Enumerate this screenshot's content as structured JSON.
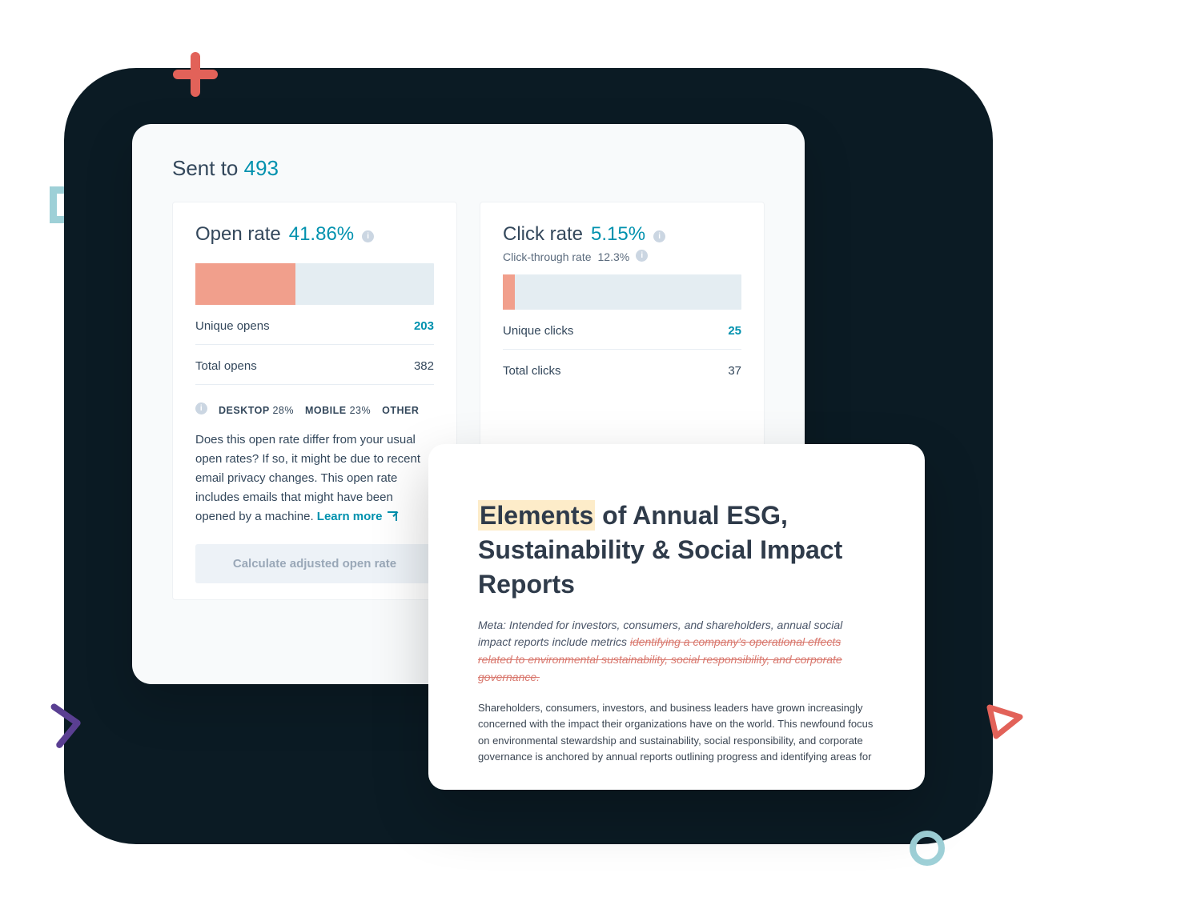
{
  "analytics": {
    "sent_label": "Sent to",
    "sent_count": "493",
    "open": {
      "title": "Open rate",
      "pct": "41.86%",
      "bar_width_pct": 41.86,
      "rows": [
        {
          "label": "Unique opens",
          "value": "203",
          "strong": true
        },
        {
          "label": "Total opens",
          "value": "382",
          "strong": false
        }
      ],
      "devices": [
        {
          "label": "DESKTOP",
          "pct": "28%"
        },
        {
          "label": "MOBILE",
          "pct": "23%"
        },
        {
          "label": "OTHER",
          "pct": ""
        }
      ],
      "explain_text": "Does this open rate differ from your usual open rates? If so, it might be due to recent email privacy changes. This open rate includes emails that might have been opened by a machine. ",
      "learn_more": "Learn more",
      "button": "Calculate adjusted open rate"
    },
    "click": {
      "title": "Click rate",
      "pct": "5.15%",
      "sub_label": "Click-through rate",
      "sub_pct": "12.3%",
      "bar_width_pct": 5.15,
      "rows": [
        {
          "label": "Unique clicks",
          "value": "25",
          "strong": true
        },
        {
          "label": "Total clicks",
          "value": "37",
          "strong": false
        }
      ]
    }
  },
  "doc": {
    "title_highlight": "Elements",
    "title_rest": " of Annual ESG, Sustainability & Social Impact Reports",
    "meta_lead": "Meta: Intended for investors, consumers, and shareholders, annual social impact reports include metrics ",
    "meta_strike": "identifying a company's operational effects related to environmental sustainability, social responsibility, and corporate governance.",
    "body": "Shareholders, consumers, investors, and business leaders have grown increasingly concerned with the impact their organizations have on the world. This newfound focus on environmental stewardship and sustainability, social responsibility, and corporate governance is anchored by annual reports outlining progress and identifying areas for"
  }
}
